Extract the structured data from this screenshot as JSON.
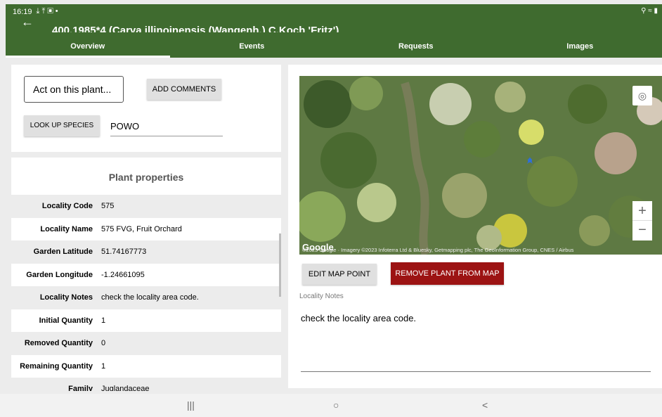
{
  "status": {
    "time": "16:19",
    "left_icons": "⤓ ⤒ ▣ •",
    "right_icons": "⚲ ≈ ▮"
  },
  "header": {
    "back_icon": "arrow-left-icon",
    "title": "400.1985*4 (Carya illinoinensis (Wangenh.) C.Koch 'Fritz')",
    "tabs": [
      {
        "label": "Overview",
        "active": true
      },
      {
        "label": "Events",
        "active": false
      },
      {
        "label": "Requests",
        "active": false
      },
      {
        "label": "Images",
        "active": false
      }
    ]
  },
  "actions": {
    "act_label": "Act on this plant...",
    "add_comments": "ADD COMMENTS",
    "look_up_species": "LOOK UP SPECIES",
    "species_source": "POWO"
  },
  "properties": {
    "title": "Plant properties",
    "rows": [
      {
        "label": "Locality Code",
        "value": "575"
      },
      {
        "label": "Locality Name",
        "value": "575 FVG, Fruit Orchard"
      },
      {
        "label": "Garden Latitude",
        "value": "51.74167773"
      },
      {
        "label": "Garden Longitude",
        "value": "-1.24661095"
      },
      {
        "label": "Locality Notes",
        "value": "check the locality area code."
      },
      {
        "label": "Initial Quantity",
        "value": "1"
      },
      {
        "label": "Removed Quantity",
        "value": "0"
      },
      {
        "label": "Remaining Quantity",
        "value": "1"
      },
      {
        "label": "Family",
        "value": "Juglandaceae"
      }
    ]
  },
  "map": {
    "logo": "Google",
    "attribution": "©2023 Google · Imagery ©2023 Infoterra Ltd & Bluesky, Getmapping plc, The GeoInformation Group, CNES / Airbus",
    "locate_icon": "my-location-icon",
    "zoom_in": "+",
    "zoom_out": "−",
    "marker_color": "#2f6fd8"
  },
  "map_actions": {
    "edit": "EDIT MAP POINT",
    "remove": "REMOVE PLANT FROM MAP"
  },
  "locality_notes": {
    "label": "Locality Notes",
    "value": "check the locality area code."
  },
  "navbar": {
    "recent": "|||",
    "home": "○",
    "back": "<"
  },
  "colors": {
    "header": "#3f6b2f",
    "danger": "#9c1313"
  }
}
